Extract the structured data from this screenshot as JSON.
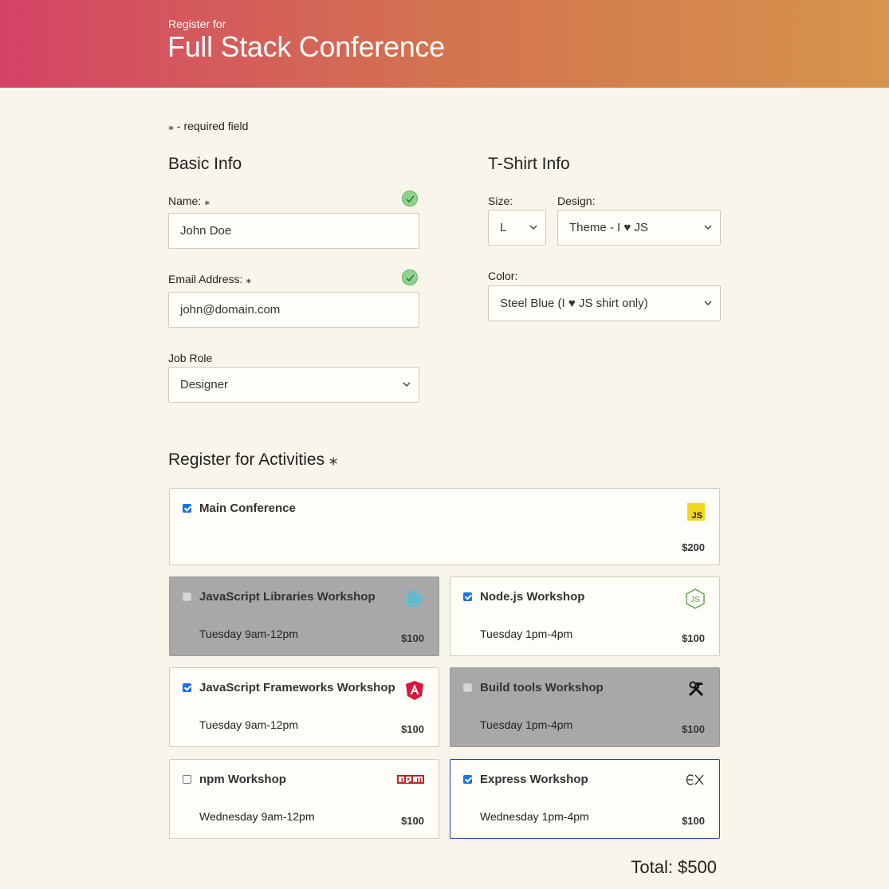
{
  "header": {
    "pretitle": "Register for",
    "title": "Full Stack Conference"
  },
  "required_note": "⁎ - required field",
  "basic_info": {
    "heading": "Basic Info",
    "name_label": "Name: ⁎",
    "name_value": "John Doe",
    "email_label": "Email Address: ⁎",
    "email_value": "john@domain.com",
    "job_label": "Job Role",
    "job_value": "Designer"
  },
  "tshirt": {
    "heading": "T-Shirt Info",
    "size_label": "Size:",
    "size_value": "L",
    "design_label": "Design:",
    "design_value": "Theme - I ♥ JS",
    "color_label": "Color:",
    "color_value": "Steel Blue (I ♥ JS shirt only)"
  },
  "activities": {
    "heading": "Register for Activities ⁎",
    "items": [
      {
        "title": "Main Conference",
        "time": "",
        "price": "$200",
        "checked": true,
        "disabled": false,
        "icon": "js-icon"
      },
      {
        "title": "JavaScript Libraries Workshop",
        "time": "Tuesday 9am-12pm",
        "price": "$100",
        "checked": false,
        "disabled": true,
        "icon": "react-icon"
      },
      {
        "title": "Node.js Workshop",
        "time": "Tuesday 1pm-4pm",
        "price": "$100",
        "checked": true,
        "disabled": false,
        "icon": "nodejs-icon"
      },
      {
        "title": "JavaScript Frameworks Workshop",
        "time": "Tuesday 9am-12pm",
        "price": "$100",
        "checked": true,
        "disabled": false,
        "icon": "angular-icon"
      },
      {
        "title": "Build tools Workshop",
        "time": "Tuesday 1pm-4pm",
        "price": "$100",
        "checked": false,
        "disabled": true,
        "icon": "tools-icon"
      },
      {
        "title": "npm Workshop",
        "time": "Wednesday 9am-12pm",
        "price": "$100",
        "checked": false,
        "disabled": false,
        "icon": "npm-icon"
      },
      {
        "title": "Express Workshop",
        "time": "Wednesday 1pm-4pm",
        "price": "$100",
        "checked": true,
        "disabled": false,
        "icon": "express-icon"
      }
    ]
  },
  "total": "Total: $500",
  "colors": {
    "header_start": "#d44366",
    "header_end": "#d6944c",
    "background": "#f9f5ea",
    "valid_green": "#90d38f",
    "focus_blue": "#1c3fc4"
  }
}
